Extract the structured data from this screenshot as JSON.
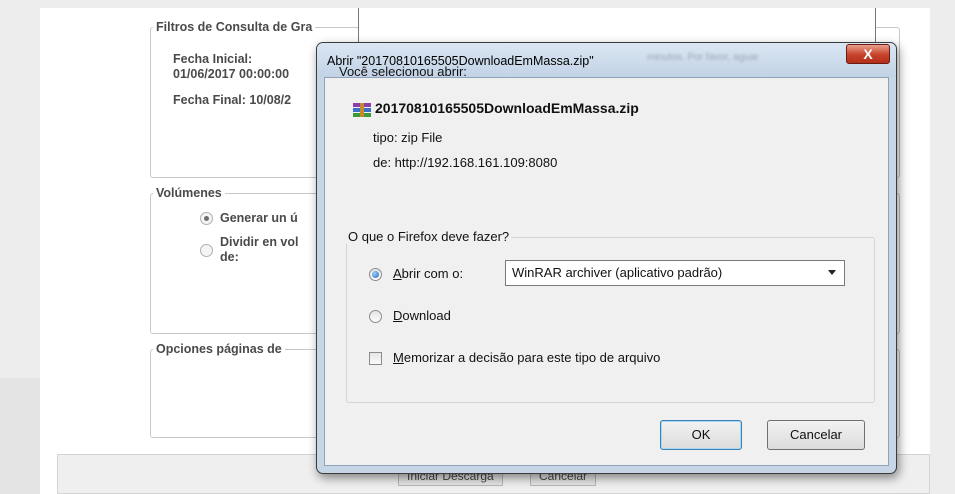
{
  "background": {
    "filters": {
      "legend": "Filtros de Consulta de Gra",
      "start_label": "Fecha Inicial:",
      "start_value": "01/06/2017 00:00:00",
      "end_label": "Fecha Final: 10/08/2"
    },
    "volumes": {
      "legend": "Volúmenes",
      "option1": "Generar un ú",
      "option2_line1": "Dividir en vol",
      "option2_line2": "de:"
    },
    "page_options": {
      "legend": "Opciones páginas de"
    },
    "buttons": {
      "start": "Iniciar Descarga",
      "cancel": "Cancelar"
    }
  },
  "dialog": {
    "title": "Abrir \"20170810165505DownloadEmMassa.zip\"",
    "title_overflow": "minutos. Por favor, aguar",
    "close_symbol": "X",
    "intro": "Você selecionou abrir:",
    "file_name": "20170810165505DownloadEmMassa.zip",
    "type_line": "tipo: zip File",
    "source_line": "de: http://192.168.161.109:8080",
    "question": "O que o Firefox deve fazer?",
    "open_with_label": "Abrir com o:",
    "open_with_mnemonic": "A",
    "open_with_rest": "brir com o:",
    "open_with_app": "WinRAR archiver (aplicativo padrão)",
    "download_mnemonic": "D",
    "download_rest": "ownload",
    "remember_mnemonic": "M",
    "remember_rest": "emorizar a decisão para este tipo de arquivo",
    "ok_label": "OK",
    "cancel_label": "Cancelar",
    "state": {
      "selected_action": "open_with",
      "remember_checked": false
    }
  },
  "colors": {
    "close_button": "#c7412a",
    "selected_radio": "#1e63b8",
    "dialog_frame": "#c7d6e6"
  },
  "icons": {
    "file": "winrar-archive-icon",
    "close": "close-icon",
    "dropdown": "chevron-down-icon"
  }
}
